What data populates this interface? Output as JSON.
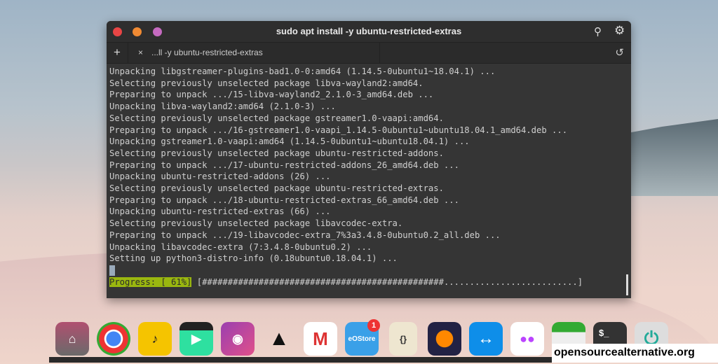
{
  "window": {
    "title": "sudo apt install -y ubuntu-restricted-extras",
    "tab_label": "...ll -y ubuntu-restricted-extras",
    "new_tab": "+",
    "close_tab": "×"
  },
  "terminal": {
    "lines": [
      "Unpacking libgstreamer-plugins-bad1.0-0:amd64 (1.14.5-0ubuntu1~18.04.1) ...",
      "Selecting previously unselected package libva-wayland2:amd64.",
      "Preparing to unpack .../15-libva-wayland2_2.1.0-3_amd64.deb ...",
      "Unpacking libva-wayland2:amd64 (2.1.0-3) ...",
      "Selecting previously unselected package gstreamer1.0-vaapi:amd64.",
      "Preparing to unpack .../16-gstreamer1.0-vaapi_1.14.5-0ubuntu1~ubuntu18.04.1_amd64.deb ...",
      "Unpacking gstreamer1.0-vaapi:amd64 (1.14.5-0ubuntu1~ubuntu18.04.1) ...",
      "Selecting previously unselected package ubuntu-restricted-addons.",
      "Preparing to unpack .../17-ubuntu-restricted-addons_26_amd64.deb ...",
      "Unpacking ubuntu-restricted-addons (26) ...",
      "Selecting previously unselected package ubuntu-restricted-extras.",
      "Preparing to unpack .../18-ubuntu-restricted-extras_66_amd64.deb ...",
      "Unpacking ubuntu-restricted-extras (66) ...",
      "Selecting previously unselected package libavcodec-extra.",
      "Preparing to unpack .../19-libavcodec-extra_7%3a3.4.8-0ubuntu0.2_all.deb ...",
      "Unpacking libavcodec-extra (7:3.4.8-0ubuntu0.2) ...",
      "Setting up python3-distro-info (0.18ubuntu0.18.04.1) ..."
    ],
    "progress_label": "Progress: [ 61%]",
    "progress_bar": " [###############################################..........................]",
    "progress_percent": 61
  },
  "dock": {
    "badge": "1",
    "store_label": "eOStore",
    "terminal_label": "$_",
    "text_editor_label": "{}"
  },
  "watermark": "opensourcealternative.org",
  "colors": {
    "close": "#e84545",
    "minimize": "#f08a33",
    "maximize": "#c56ac0",
    "progress": "#9ab70f"
  }
}
